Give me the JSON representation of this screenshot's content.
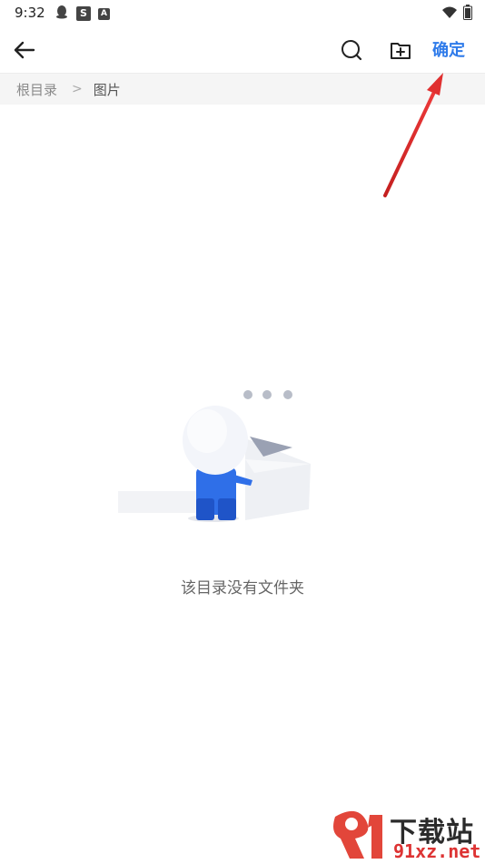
{
  "status_bar": {
    "time": "9:32",
    "left_icons": [
      "qq-icon",
      "s-app-icon",
      "a-app-icon"
    ],
    "right_icons": [
      "wifi-icon",
      "battery-icon"
    ],
    "s_glyph": "S",
    "a_glyph": "A"
  },
  "toolbar": {
    "back_icon": "arrow-left-icon",
    "search_icon": "search-icon",
    "new_folder_icon": "folder-plus-icon",
    "confirm_label": "确定"
  },
  "breadcrumb": {
    "root": "根目录",
    "separator": ">",
    "current": "图片"
  },
  "empty_state": {
    "message": "该目录没有文件夹",
    "illustration": "empty-folder-illustration"
  },
  "watermark": {
    "brand_top": "下载站",
    "brand_bottom": "91xz.net"
  },
  "colors": {
    "accent": "#2f7bea",
    "annotation": "#d92626",
    "breadcrumb_bg": "#f5f5f5"
  }
}
